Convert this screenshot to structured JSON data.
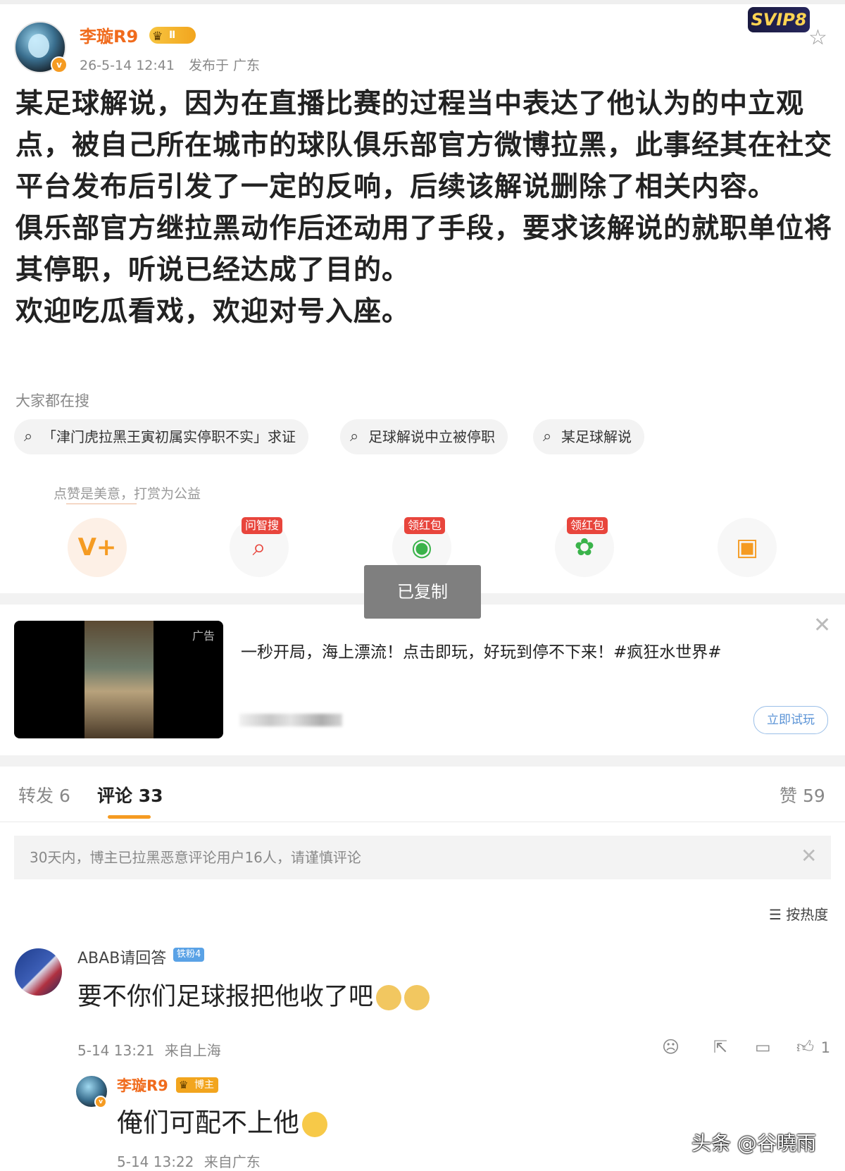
{
  "post": {
    "author": "李璇R9",
    "level_badge": "Ⅱ",
    "time": "26-5-14 12:41",
    "location": "发布于 广东",
    "content": "某足球解说，因为在直播比赛的过程当中表达了他认为的中立观点，被自己所在城市的球队俱乐部官方微博拉黑，此事经其在社交平台发布后引发了一定的反响，后续该解说删除了相关内容。\n俱乐部官方继拉黑动作后还动用了手段，要求该解说的就职单位将其停职，听说已经达成了目的。\n欢迎吃瓜看戏，欢迎对号入座。"
  },
  "vip_badge": "SVIP8",
  "hot_search": {
    "title": "大家都在搜",
    "items": [
      "「津门虎拉黑王寅初属实停职不实」求证",
      "足球解说中立被停职",
      "某足球解说"
    ]
  },
  "tip": {
    "label": "点赞是美意，打赏为公益",
    "tags": [
      "问智搜",
      "领红包",
      "领红包"
    ]
  },
  "toast": "已复制",
  "ad": {
    "tag": "广告",
    "text": "一秒开局，海上漂流！点击即玩，好玩到停不下来！#疯狂水世界#",
    "button": "立即试玩"
  },
  "tabs": {
    "repost": "转发 6",
    "comments": "评论 33",
    "likes": "赞 59"
  },
  "notice": "30天内，博主已拉黑恶意评论用户16人，请谨慎评论",
  "sort": "按热度",
  "comment": {
    "user": "ABAB请回答",
    "fan_badge": "铁粉4",
    "text": "要不你们足球报把他收了吧",
    "time": "5-14 13:21",
    "location": "来自上海",
    "likes": "1"
  },
  "reply": {
    "user": "李璇R9",
    "badge": "博主",
    "text": "俺们可配不上他",
    "time": "5-14 13:22",
    "location": "来自广东"
  },
  "watermark": "头条 @谷曉雨",
  "colors": {
    "accent": "#f06b1d",
    "tab_underline": "#f59b22",
    "red_tag": "#e8453c"
  }
}
